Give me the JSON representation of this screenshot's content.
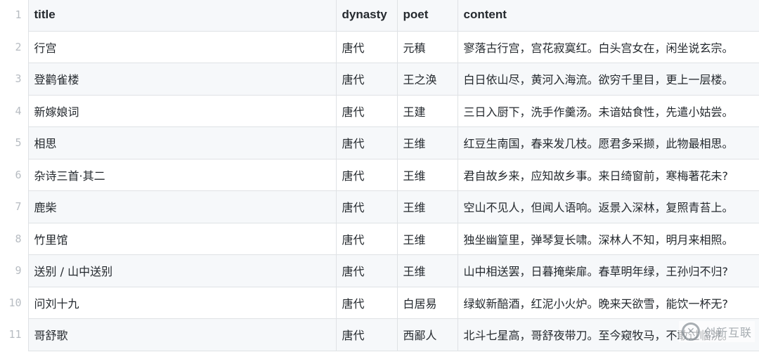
{
  "table": {
    "line_numbers": [
      "1",
      "2",
      "3",
      "4",
      "5",
      "6",
      "7",
      "8",
      "9",
      "10",
      "11"
    ],
    "headers": [
      "title",
      "dynasty",
      "poet",
      "content"
    ],
    "rows": [
      {
        "title": "行宫",
        "dynasty": "唐代",
        "poet": "元稹",
        "content": "寥落古行宫，宫花寂寞红。白头宫女在，闲坐说玄宗。"
      },
      {
        "title": "登鹳雀楼",
        "dynasty": "唐代",
        "poet": "王之涣",
        "content": "白日依山尽，黄河入海流。欲穷千里目，更上一层楼。"
      },
      {
        "title": "新嫁娘词",
        "dynasty": "唐代",
        "poet": "王建",
        "content": "三日入厨下，洗手作羹汤。未谙姑食性，先遣小姑尝。"
      },
      {
        "title": "相思",
        "dynasty": "唐代",
        "poet": "王维",
        "content": "红豆生南国，春来发几枝。愿君多采撷，此物最相思。"
      },
      {
        "title": "杂诗三首·其二",
        "dynasty": "唐代",
        "poet": "王维",
        "content": "君自故乡来，应知故乡事。来日绮窗前，寒梅著花未?"
      },
      {
        "title": "鹿柴",
        "dynasty": "唐代",
        "poet": "王维",
        "content": "空山不见人，但闻人语响。返景入深林，复照青苔上。"
      },
      {
        "title": "竹里馆",
        "dynasty": "唐代",
        "poet": "王维",
        "content": "独坐幽篁里，弹琴复长啸。深林人不知，明月来相照。"
      },
      {
        "title": "送别 / 山中送别",
        "dynasty": "唐代",
        "poet": "王维",
        "content": "山中相送罢，日暮掩柴扉。春草明年绿，王孙归不归?"
      },
      {
        "title": "问刘十九",
        "dynasty": "唐代",
        "poet": "白居易",
        "content": "绿蚁新醅酒，红泥小火炉。晚来天欲雪，能饮一杯无?"
      },
      {
        "title": "哥舒歌",
        "dynasty": "唐代",
        "poet": "西鄙人",
        "content": "北斗七星高，哥舒夜带刀。至今窥牧马，不敢过临洮。"
      }
    ]
  },
  "watermark": {
    "logo_glyph": "✕",
    "text": "创新互联"
  },
  "colors": {
    "header_bg": "#f6f8fa",
    "border": "#dfe2e5",
    "line_number": "#b7bcc2",
    "text": "#24292e"
  }
}
